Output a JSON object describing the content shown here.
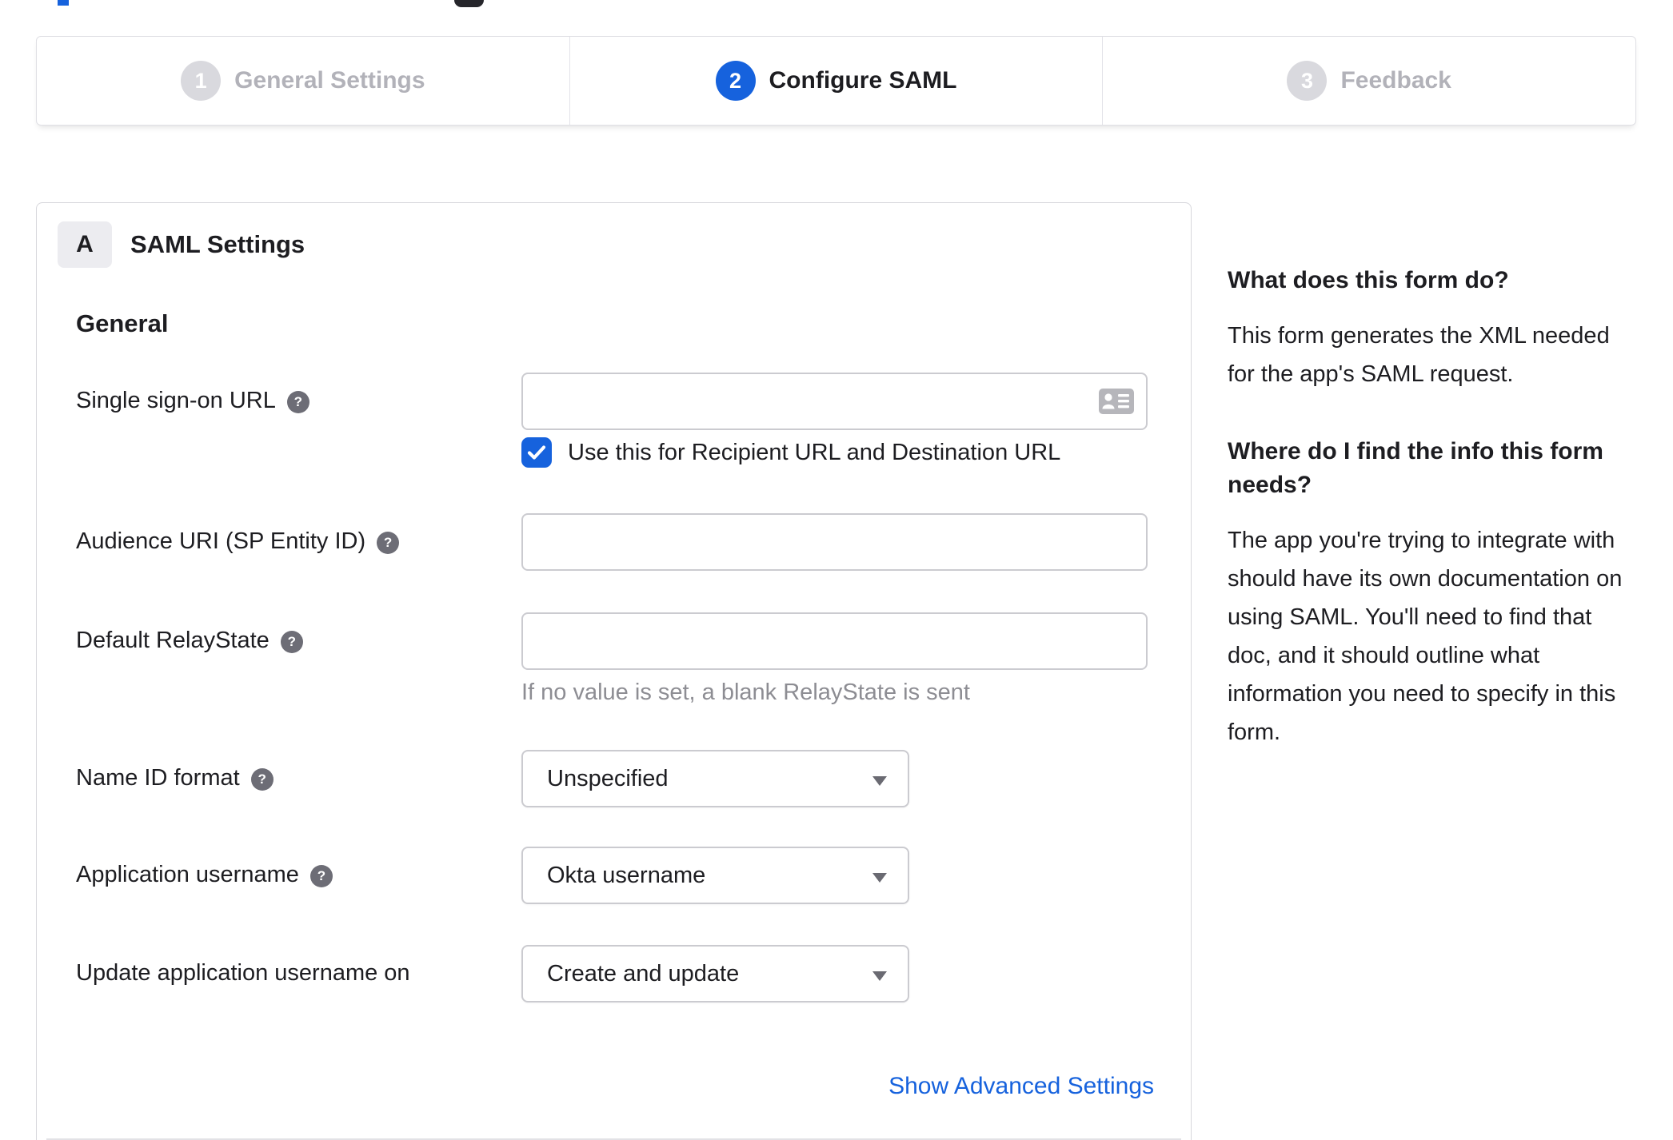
{
  "colors": {
    "accent_blue": "#1662dd",
    "link_blue": "#1662dd",
    "step_inactive_circle": "#d9d9de",
    "step_inactive_text": "#b2b2b9",
    "text_dark": "#1d1d21",
    "hint_gray": "#8d8d93",
    "help_icon_gray": "#6d6d76"
  },
  "stepper": {
    "steps": [
      {
        "number": "1",
        "label": "General Settings",
        "state": "inactive"
      },
      {
        "number": "2",
        "label": "Configure SAML",
        "state": "active"
      },
      {
        "number": "3",
        "label": "Feedback",
        "state": "inactive"
      }
    ]
  },
  "panel": {
    "badge": "A",
    "title": "SAML Settings",
    "section_title": "General",
    "fields": [
      {
        "label": "Single sign-on URL",
        "value": "",
        "checkbox_label": "Use this for Recipient URL and Destination URL",
        "checkbox_checked": true
      },
      {
        "label": "Audience URI (SP Entity ID)",
        "value": ""
      },
      {
        "label": "Default RelayState",
        "value": "",
        "hint": "If no value is set, a blank RelayState is sent"
      },
      {
        "label": "Name ID format",
        "value": "Unspecified"
      },
      {
        "label": "Application username",
        "value": "Okta username"
      },
      {
        "label": "Update application username on",
        "value": "Create and update"
      }
    ],
    "advanced_link": "Show Advanced Settings"
  },
  "icons": {
    "help_glyph": "?"
  },
  "sidebar": {
    "sections": [
      {
        "heading": "What does this form do?",
        "body": "This form generates the XML needed\nfor the app's SAML request."
      },
      {
        "heading": "Where do I find the info this form\nneeds?",
        "body": "The app you're trying to integrate with\nshould have its own documentation on\nusing SAML. You'll need to find that\ndoc, and it should outline what\ninformation you need to specify in this\nform."
      }
    ]
  }
}
